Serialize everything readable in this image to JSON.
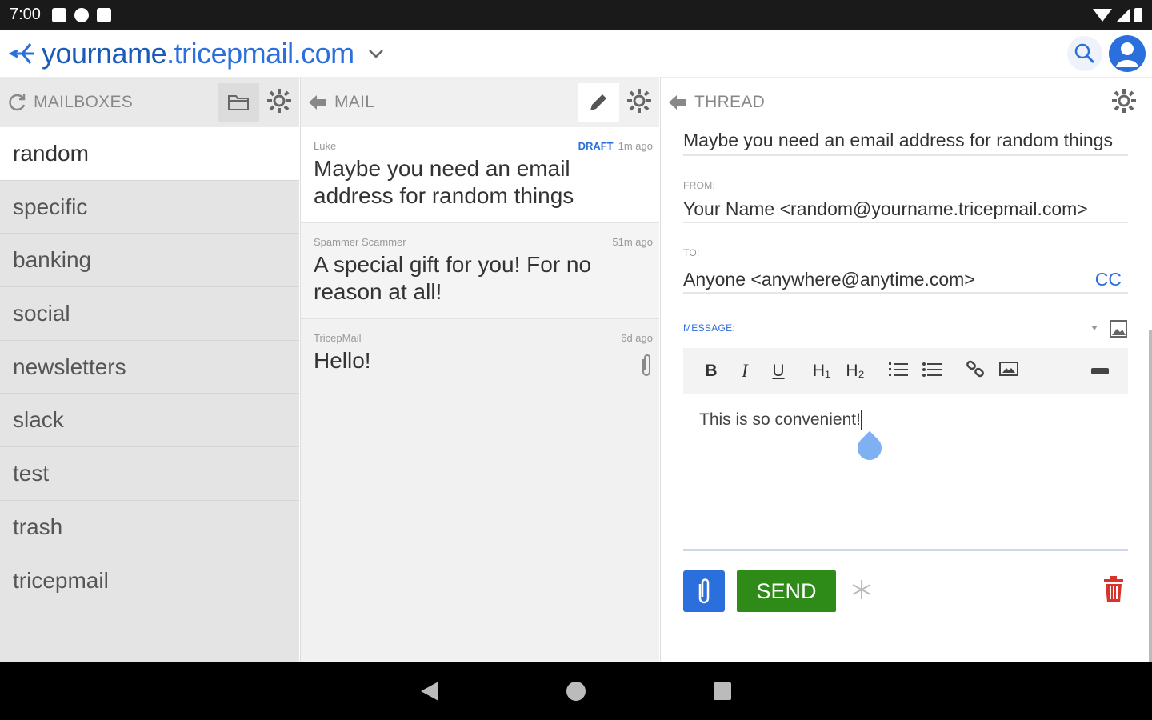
{
  "status": {
    "time": "7:00"
  },
  "app": {
    "title_prefix": "yourname",
    "title_rest": ".tricepmail.com"
  },
  "colors": {
    "accent": "#2a6fdb",
    "send": "#2e8b17",
    "danger": "#d9342b"
  },
  "mailboxes": {
    "header": "MAILBOXES",
    "items": [
      {
        "label": "random"
      },
      {
        "label": "specific"
      },
      {
        "label": "banking"
      },
      {
        "label": "social"
      },
      {
        "label": "newsletters"
      },
      {
        "label": "slack"
      },
      {
        "label": "test"
      },
      {
        "label": "trash"
      },
      {
        "label": "tricepmail"
      }
    ]
  },
  "mail": {
    "header": "MAIL",
    "items": [
      {
        "from": "Luke",
        "badge": "DRAFT",
        "time": "1m ago",
        "subject": "Maybe you need an email address for random things"
      },
      {
        "from": "Spammer Scammer",
        "time": "51m ago",
        "subject": "A special gift for you! For no reason at all!"
      },
      {
        "from": "TricepMail",
        "time": "6d ago",
        "subject": "Hello!"
      }
    ]
  },
  "thread": {
    "header": "THREAD",
    "subject": "Maybe you need an email address for random things",
    "from_label": "FROM:",
    "from_value": "Your Name <random@yourname.tricepmail.com>",
    "to_label": "TO:",
    "to_value": "Anyone <anywhere@anytime.com>",
    "cc_label": "CC",
    "message_label": "MESSAGE:",
    "toolbar": {
      "bold": "B",
      "italic": "I",
      "underline": "U",
      "h1": "H₁",
      "h2": "H₂"
    },
    "body": "This is so convenient!",
    "send_label": "SEND"
  }
}
